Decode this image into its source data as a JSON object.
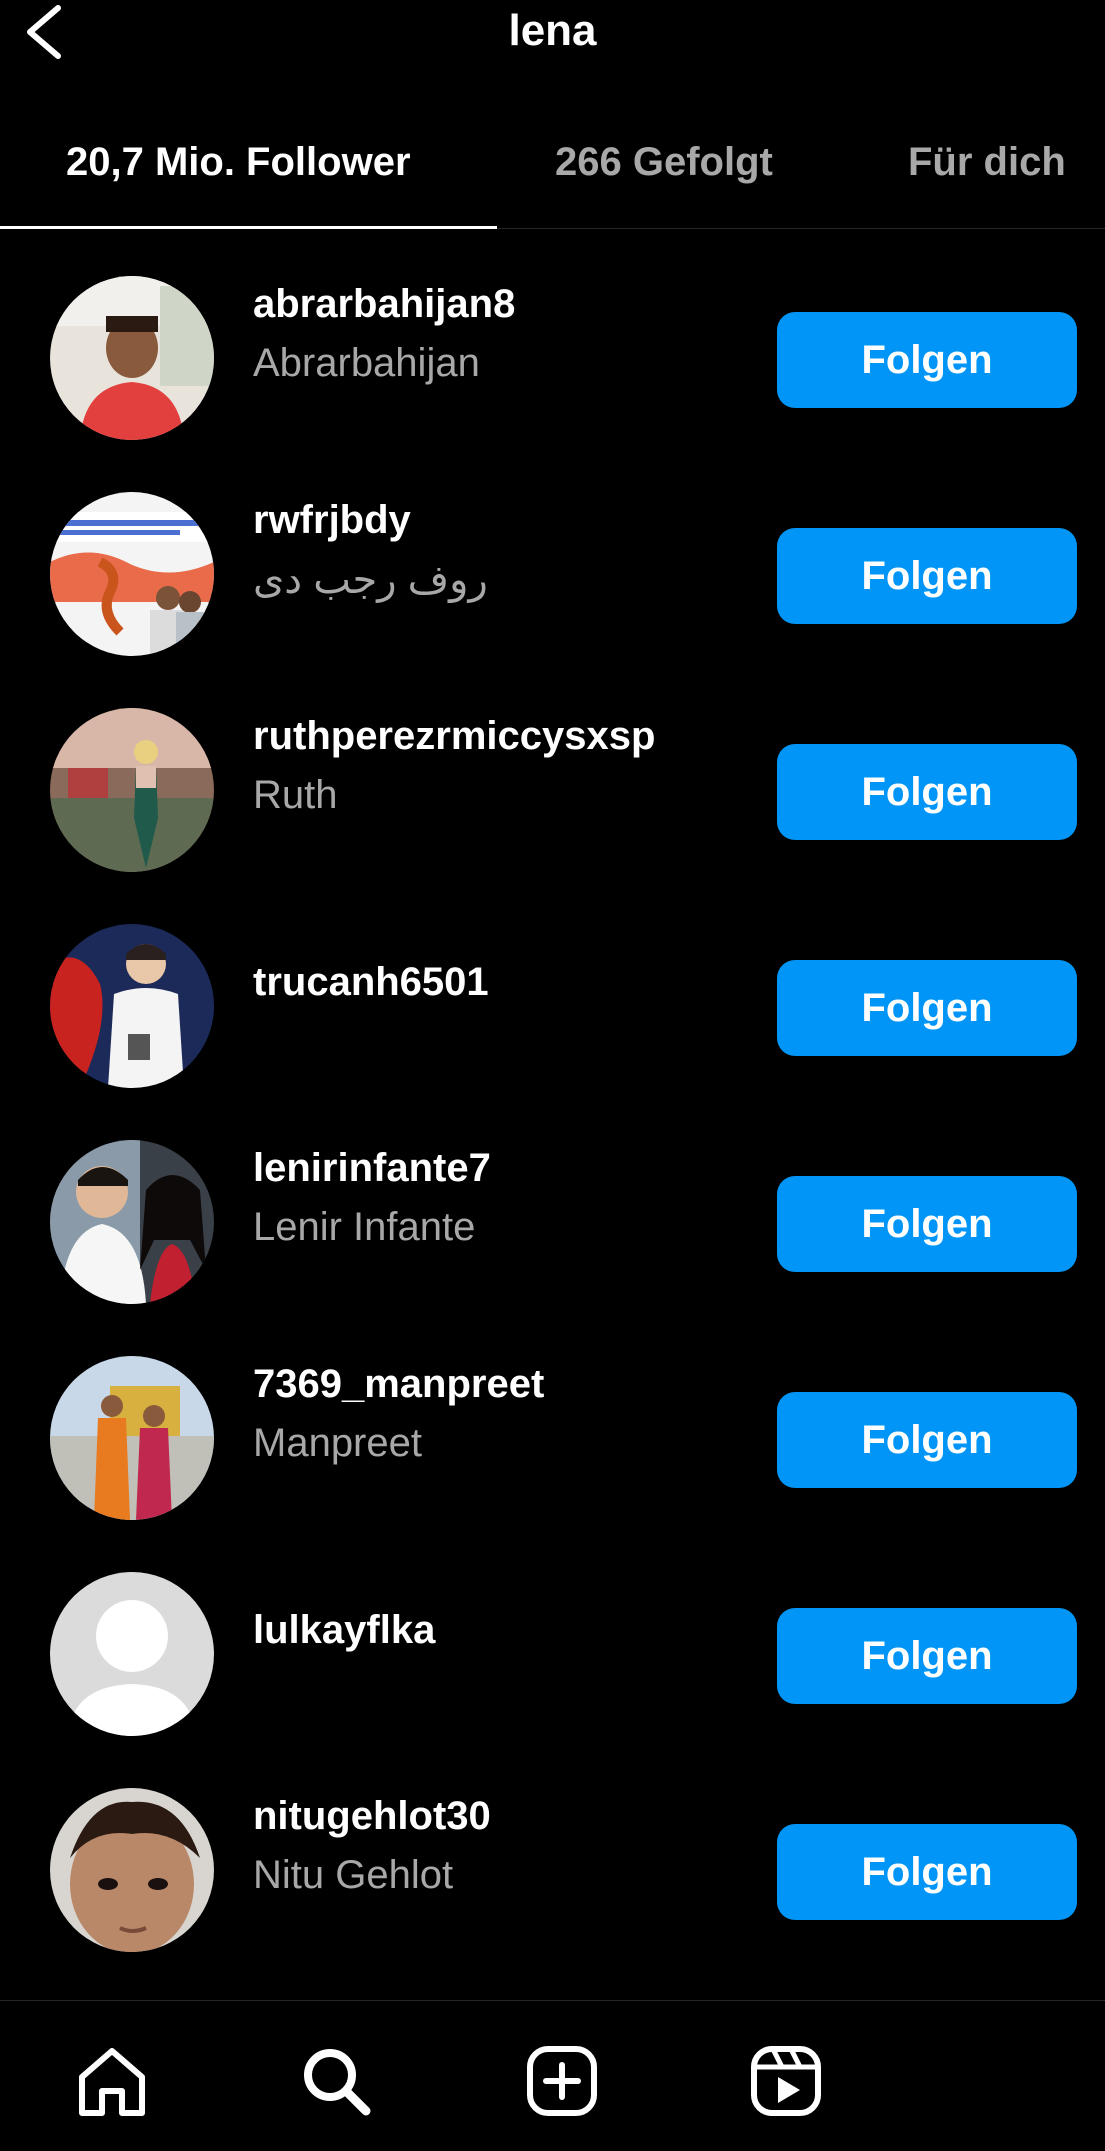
{
  "header": {
    "title": "lena",
    "back_icon": "chevron-left-icon"
  },
  "tabs": [
    {
      "label": "20,7 Mio. Follower",
      "active": true
    },
    {
      "label": "266 Gefolgt",
      "active": false
    },
    {
      "label": "Für dich",
      "active": false
    }
  ],
  "rows": [
    {
      "username": "abrarbahijan8",
      "fullname": "Abrarbahijan",
      "button": "Folgen"
    },
    {
      "username": "rwfrjbdy",
      "fullname": "روف رجب دی",
      "button": "Folgen"
    },
    {
      "username": "ruthperezrmiccysxsp",
      "fullname": "Ruth",
      "button": "Folgen"
    },
    {
      "username": "trucanh6501",
      "fullname": "",
      "button": "Folgen"
    },
    {
      "username": "lenirinfante7",
      "fullname": "Lenir Infante",
      "button": "Folgen"
    },
    {
      "username": "7369_manpreet",
      "fullname": "Manpreet",
      "button": "Folgen"
    },
    {
      "username": "lulkayflka",
      "fullname": "",
      "button": "Folgen"
    },
    {
      "username": "nitugehlot30",
      "fullname": "Nitu Gehlot",
      "button": "Folgen"
    }
  ],
  "bottom_nav": [
    {
      "icon": "home-icon"
    },
    {
      "icon": "search-icon",
      "active": true
    },
    {
      "icon": "create-post-icon"
    },
    {
      "icon": "reels-icon"
    }
  ],
  "colors": {
    "accent": "#0095f6",
    "background": "#000000",
    "secondary_text": "#a8a8a8"
  }
}
